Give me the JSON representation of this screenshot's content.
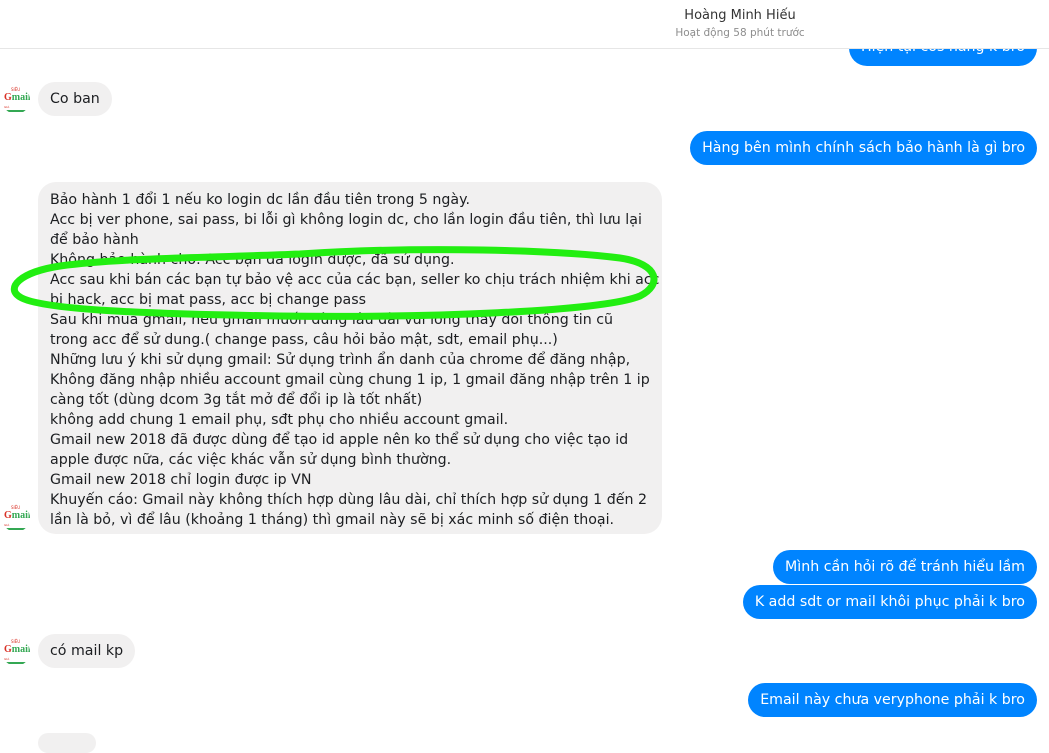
{
  "header": {
    "contact_name": "Hoàng Minh Hiếu",
    "status": "Hoạt động 58 phút trước"
  },
  "messages": {
    "m1": "Hiện tại cos hàng k bro",
    "m2": "Co ban",
    "m3": "Hàng bên mình chính sách bảo hành là gì bro",
    "m4": [
      "Bảo hành 1 đổi 1 nếu ko login dc lần đầu tiên trong 5 ngày.",
      "Acc bị ver phone, sai pass, bi lỗi gì không login dc, cho lần login đầu tiên, thì lưu lại",
      "để bảo hành",
      "Không bảo hành cho: Acc bạn đã login được, đã sử dụng.",
      "Acc sau khi bán các bạn tự bảo vệ acc của các bạn, seller ko chịu trách nhiệm khi acc",
      "bị hack, acc bị mat pass, acc bị change pass",
      "Sau khi mua gmail, nếu gmail muốn dùng lâu dài vui lòng thay đổi thông tin cũ",
      "trong acc để sử dung.( change pass, câu hỏi bảo mật, sdt, email phụ...)",
      "Những lưu ý khi sử dụng gmail: Sử dụng trình ẩn danh của chrome để đăng nhập,",
      "Không đăng nhập nhiều account gmail cùng chung 1 ip, 1 gmail đăng nhập trên 1 ip",
      "càng tốt (dùng dcom 3g tắt mở để đổi ip là tốt nhất)",
      "không add chung 1 email phụ, sđt phụ cho nhiều account gmail.",
      "Gmail new 2018 đã được dùng để tạo id apple nên ko thể sử dụng cho việc tạo id",
      "apple được nữa, các việc khác vẫn sử dụng bình thường.",
      "Gmail new 2018 chỉ login được ip VN",
      "Khuyến cáo: Gmail này không thích hợp dùng lâu dài, chỉ thích hợp sử dụng 1 đến 2",
      "lần là bỏ, vì để lâu (khoảng 1 tháng) thì gmail này sẽ bị xác minh số điện thoại."
    ],
    "m5": "Mình cần hỏi rõ để tránh hiểu lầm",
    "m6": "K add sdt or mail khôi phục phải k bro",
    "m7": "có mail kp",
    "m8": "Email này chưa veryphone phải k bro"
  },
  "avatar": {
    "logo_text": "Gmail",
    "top_text": "SIÊU",
    "bottom_text": "GIÁ"
  },
  "colors": {
    "outgoing_bubble": "#0084ff",
    "incoming_bubble": "#f1f0f0",
    "annotation": "#22ee11"
  }
}
